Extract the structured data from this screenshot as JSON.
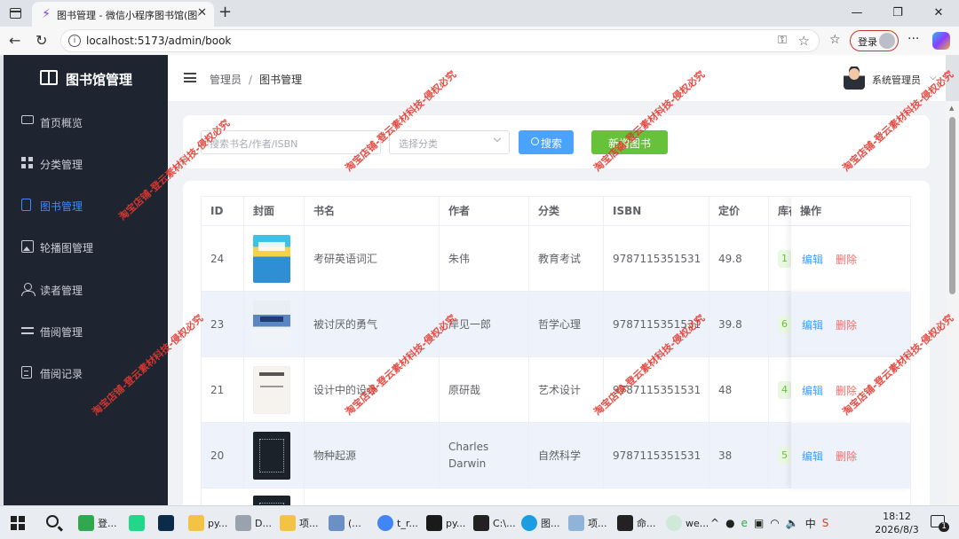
{
  "browser": {
    "tab_title": "图书管理 - 微信小程序图书馆(图书",
    "url": "localhost:5173/admin/book",
    "login_label": "登录"
  },
  "sidebar": {
    "title": "图书馆管理",
    "items": [
      {
        "label": "首页概览",
        "icon": "monitor-icon",
        "active": false
      },
      {
        "label": "分类管理",
        "icon": "grid-icon",
        "active": false
      },
      {
        "label": "图书管理",
        "icon": "book-icon",
        "active": true
      },
      {
        "label": "轮播图管理",
        "icon": "image-icon",
        "active": false
      },
      {
        "label": "读者管理",
        "icon": "user-icon",
        "active": false
      },
      {
        "label": "借阅管理",
        "icon": "swap-icon",
        "active": false
      },
      {
        "label": "借阅记录",
        "icon": "document-icon",
        "active": false
      }
    ]
  },
  "header": {
    "breadcrumb": [
      "管理员",
      "图书管理"
    ],
    "separator": "/",
    "admin_name": "系统管理员"
  },
  "search": {
    "keyword_placeholder": "搜索书名/作者/ISBN",
    "category_placeholder": "选择分类",
    "search_label": "搜索",
    "add_label": "新增图书"
  },
  "table": {
    "columns": [
      "ID",
      "封面",
      "书名",
      "作者",
      "分类",
      "ISBN",
      "定价",
      "库存",
      "操作"
    ],
    "rows": [
      {
        "id": "24",
        "title": "考研英语词汇",
        "author": "朱伟",
        "category": "教育考试",
        "isbn": "9787115351531",
        "price": "49.8",
        "stock": "1",
        "cover": "cover-a"
      },
      {
        "id": "23",
        "title": "被讨厌的勇气",
        "author": "岸见一郎",
        "category": "哲学心理",
        "isbn": "9787115351531",
        "price": "39.8",
        "stock": "6",
        "cover": "cover-b"
      },
      {
        "id": "21",
        "title": "设计中的设计",
        "author": "原研哉",
        "category": "艺术设计",
        "isbn": "9787115351531",
        "price": "48",
        "stock": "4",
        "cover": "cover-c"
      },
      {
        "id": "20",
        "title": "物种起源",
        "author": "Charles Darwin",
        "category": "自然科学",
        "isbn": "9787115351531",
        "price": "38",
        "stock": "5",
        "cover": "cover-d"
      }
    ],
    "edit_label": "编辑",
    "delete_label": "删除"
  },
  "watermark_text": "淘宝店铺-登云素材科技-侵权必究",
  "taskbar": {
    "items": [
      "登...",
      "",
      "",
      "py...",
      "D...",
      "项...",
      "(...",
      "t_r...",
      "py...",
      "C:\\...",
      "图...",
      "项...",
      "命...",
      "we..."
    ],
    "time": "18:12",
    "date": "2026/8/3",
    "notification_count": "1"
  },
  "colors": {
    "sidebar_bg": "#1e2430",
    "primary": "#409eff",
    "success": "#67c23a",
    "danger": "#f56c6c"
  }
}
